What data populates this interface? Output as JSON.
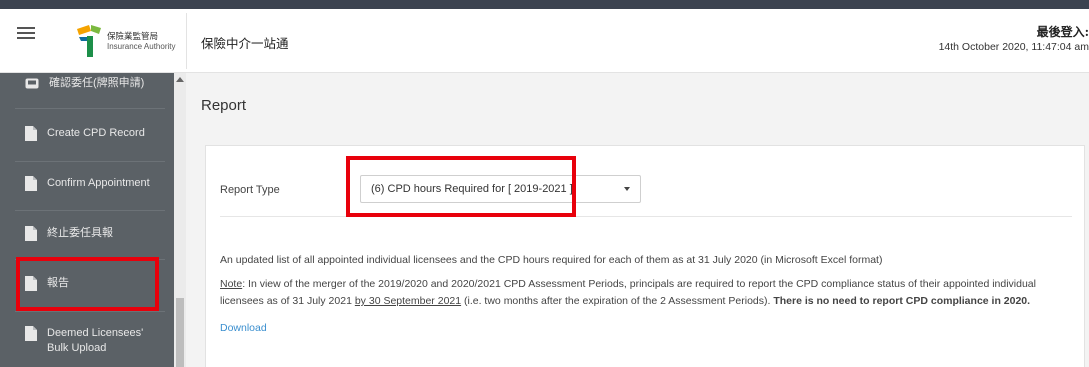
{
  "header": {
    "logo_zh": "保險業監管局",
    "logo_en": "Insurance Authority",
    "site_title": "保險中介一站通",
    "login_label": "最後登入:",
    "login_time": "14th October 2020, 11:47:04 am"
  },
  "sidebar": {
    "items": [
      {
        "label": "確認委任(牌照申請)"
      },
      {
        "label": "Create CPD Record"
      },
      {
        "label": "Confirm Appointment"
      },
      {
        "label": "終止委任具報"
      },
      {
        "label": "報告"
      },
      {
        "label": "Deemed Licensees'"
      },
      {
        "label": "Bulk Upload"
      }
    ]
  },
  "main": {
    "page_title": "Report",
    "report_type_label": "Report Type",
    "report_type_value": "(6) CPD hours Required for [ 2019-2021 ]",
    "description": "An updated list of all appointed individual licensees and the CPD hours required for each of them as at 31 July 2020 (in Microsoft Excel format)",
    "note": {
      "label": "Note",
      "text1": ": In view of the merger of the 2019/2020 and 2020/2021 CPD Assessment Periods, principals are required to report the CPD compliance status of their appointed individual licensees as of 31 July 2021 ",
      "deadline": "by 30 September 2021",
      "text2": " (i.e. two months after the expiration of the 2 Assessment Periods). ",
      "bold": "There is no need to report CPD compliance in 2020."
    },
    "download_label": "Download"
  },
  "colors": {
    "sidebar_bg": "#5b6166",
    "highlight": "#e8000b",
    "link": "#3b8fcf",
    "main_bg": "#f3f3f3"
  },
  "icons": [
    "menu-icon",
    "insurance-authority-logo",
    "inbox-icon",
    "document-icon",
    "dropdown-arrow-icon"
  ]
}
